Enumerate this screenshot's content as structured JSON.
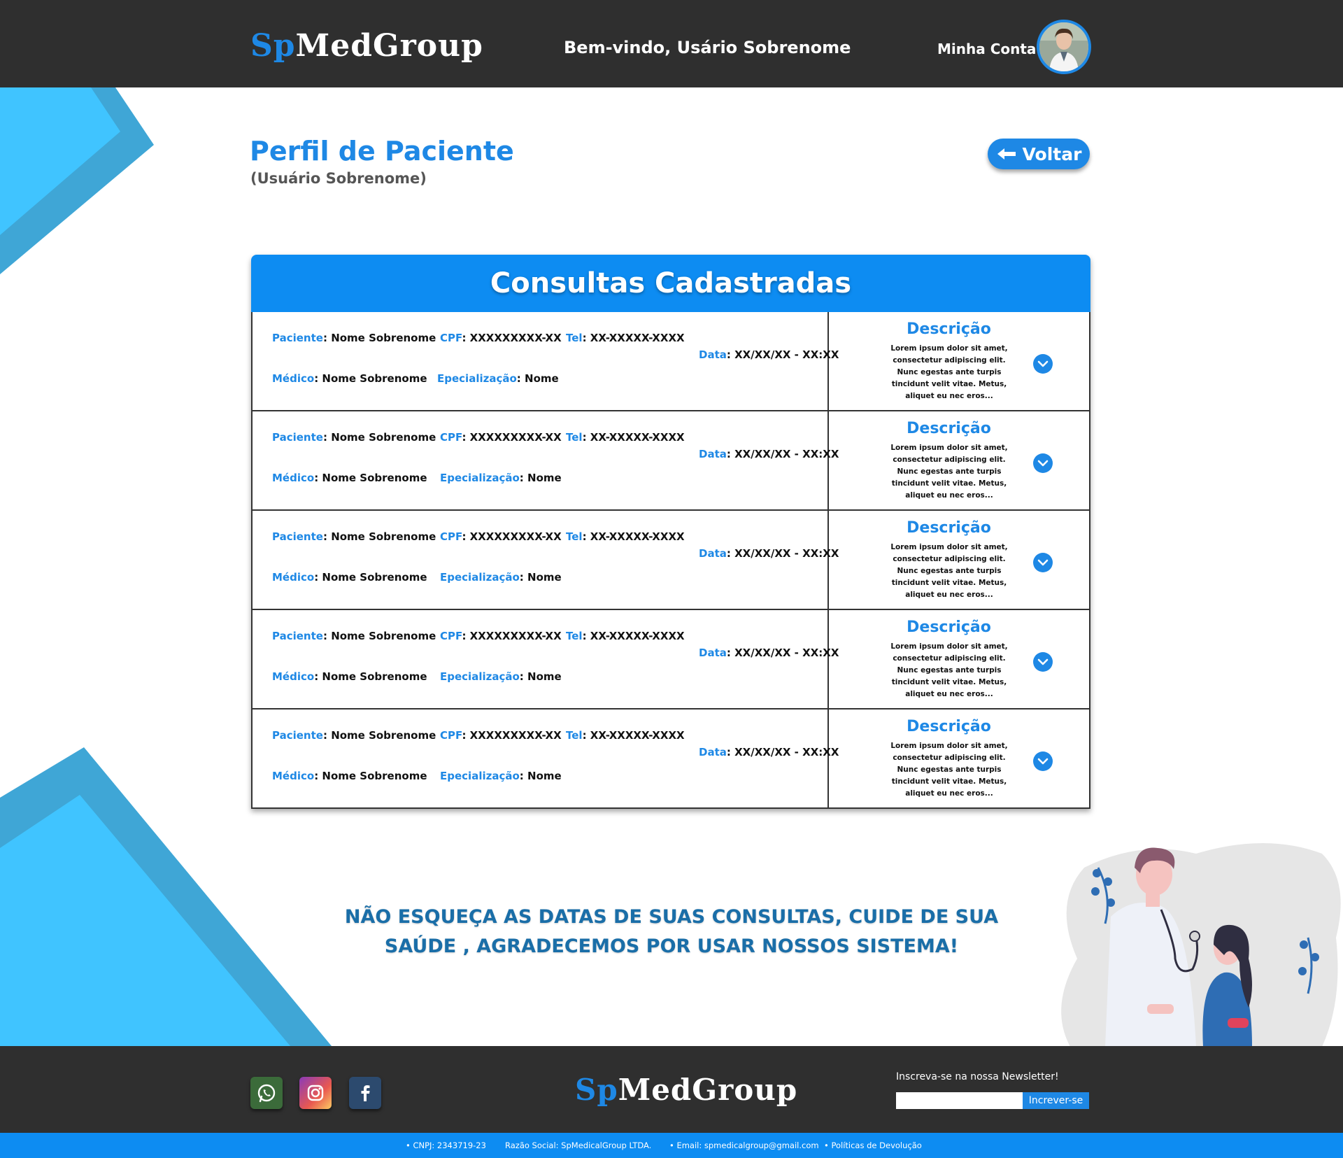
{
  "brand": {
    "sp": "Sp",
    "rest": "MedGroup"
  },
  "header": {
    "welcome": "Bem-vindo, Usário Sobrenome",
    "account_label": "Minha Conta"
  },
  "profile": {
    "title": "Perfil de Paciente",
    "subtitle": "(Usuário Sobrenome)",
    "back_label": "Voltar"
  },
  "consultas": {
    "title": "Consultas Cadastradas",
    "labels": {
      "paciente": "Paciente",
      "cpf": "CPF",
      "tel": "Tel",
      "data": "Data",
      "medico": "Médico",
      "especializacao": "Epecialização",
      "descricao": "Descrição"
    },
    "rows": [
      {
        "paciente": "Nome Sobrenome",
        "cpf": "XXXXXXXXX-XX",
        "tel": "XX-XXXXX-XXXX",
        "data": "XX/XX/XX - XX:XX",
        "medico": "Nome Sobrenome",
        "especializacao": "Nome",
        "descricao": "Lorem ipsum dolor sit amet, consectetur adipiscing elit. Nunc egestas ante turpis tincidunt velit vitae. Metus, aliquet eu nec eros..."
      },
      {
        "paciente": "Nome Sobrenome",
        "cpf": "XXXXXXXXX-XX",
        "tel": "XX-XXXXX-XXXX",
        "data": "XX/XX/XX - XX:XX",
        "medico": "Nome Sobrenome",
        "especializacao": "Nome",
        "descricao": "Lorem ipsum dolor sit amet, consectetur adipiscing elit. Nunc egestas ante turpis tincidunt velit vitae. Metus, aliquet eu nec eros..."
      },
      {
        "paciente": "Nome Sobrenome",
        "cpf": "XXXXXXXXX-XX",
        "tel": "XX-XXXXX-XXXX",
        "data": "XX/XX/XX - XX:XX",
        "medico": "Nome Sobrenome",
        "especializacao": "Nome",
        "descricao": "Lorem ipsum dolor sit amet, consectetur adipiscing elit. Nunc egestas ante turpis tincidunt velit vitae. Metus, aliquet eu nec eros..."
      },
      {
        "paciente": "Nome Sobrenome",
        "cpf": "XXXXXXXXX-XX",
        "tel": "XX-XXXXX-XXXX",
        "data": "XX/XX/XX - XX:XX",
        "medico": "Nome Sobrenome",
        "especializacao": "Nome",
        "descricao": "Lorem ipsum dolor sit amet, consectetur adipiscing elit. Nunc egestas ante turpis tincidunt velit vitae. Metus, aliquet eu nec eros..."
      },
      {
        "paciente": "Nome Sobrenome",
        "cpf": "XXXXXXXXX-XX",
        "tel": "XX-XXXXX-XXXX",
        "data": "XX/XX/XX - XX:XX",
        "medico": "Nome Sobrenome",
        "especializacao": "Nome",
        "descricao": "Lorem ipsum dolor sit amet, consectetur adipiscing elit. Nunc egestas ante turpis tincidunt velit vitae. Metus, aliquet eu nec eros..."
      }
    ]
  },
  "message": {
    "line1": "NÃO ESQUEÇA AS DATAS DE SUAS CONSULTAS, CUIDE DE SUA",
    "line2": "SAÚDE , AGRADECEMOS POR USAR NOSSOS SISTEMA!"
  },
  "footer": {
    "social": [
      "whatsapp-icon",
      "instagram-icon",
      "facebook-icon"
    ],
    "newsletter_label": "Inscreva-se na nossa Newsletter!",
    "newsletter_placeholder": "",
    "newsletter_button": "Increver-se"
  },
  "bottom_bar": {
    "cnpj": "• CNPJ: 2343719-23",
    "razao": "Razão Social: SpMedicalGroup LTDA.",
    "email": "• Email: spmedicalgroup@gmail.com",
    "politicas": "• Políticas de Devolução"
  },
  "colors": {
    "primary": "#1e88e5",
    "header_bg": "#2f2f2f",
    "accent_light": "#40c4ff",
    "accent_dark": "#3fa6d6"
  }
}
